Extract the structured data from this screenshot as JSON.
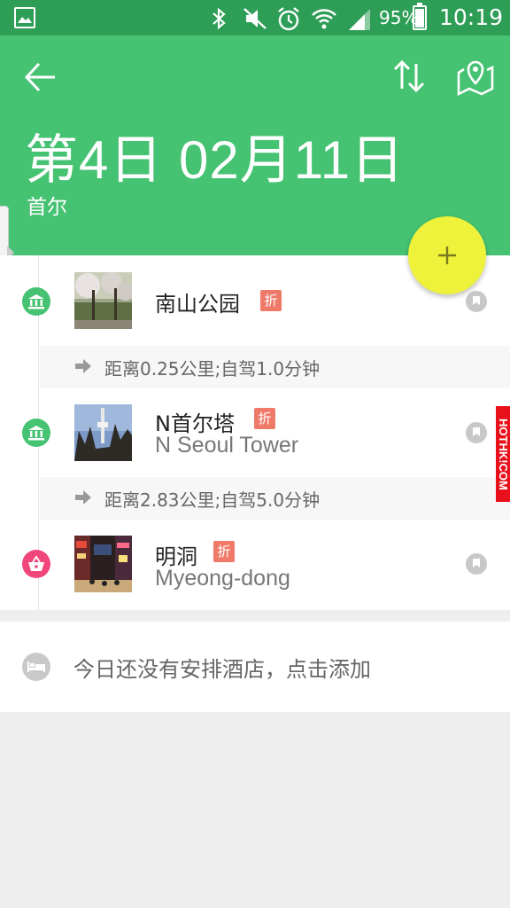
{
  "status_bar": {
    "battery_percent": "95%",
    "battery_level": 0.95,
    "time": "10:19",
    "icons": [
      "gallery-icon",
      "bluetooth-icon",
      "mute-icon",
      "alarm-icon",
      "wifi-icon",
      "signal-icon",
      "battery-icon"
    ]
  },
  "header": {
    "title": "第4日 02月11日",
    "city": "首尔",
    "background_color": "#45c272",
    "icons": [
      "back-arrow-icon",
      "sort-icon",
      "map-icon"
    ]
  },
  "fab": {
    "icon": "plus-icon",
    "color": "#eef23a"
  },
  "itinerary": {
    "items": [
      {
        "name": "南山公园",
        "subtitle": "",
        "badge": "折",
        "type_icon": "museum-icon",
        "type_color": "#45c272"
      },
      {
        "name": "N首尔塔",
        "subtitle": "N Seoul Tower",
        "badge": "折",
        "type_icon": "museum-icon",
        "type_color": "#45c272"
      },
      {
        "name": "明洞",
        "subtitle": "Myeong-dong",
        "badge": "折",
        "type_icon": "shopping-basket-icon",
        "type_color": "#f0467a"
      }
    ],
    "distances": [
      "距离0.25公里;自驾1.0分钟",
      "距离2.83公里;自驾5.0分钟"
    ]
  },
  "hotel": {
    "text": "今日还没有安排酒店，点击添加",
    "icon": "bed-icon"
  },
  "watermark": "HOTHK!COM",
  "badge_color": "#f07a6a"
}
